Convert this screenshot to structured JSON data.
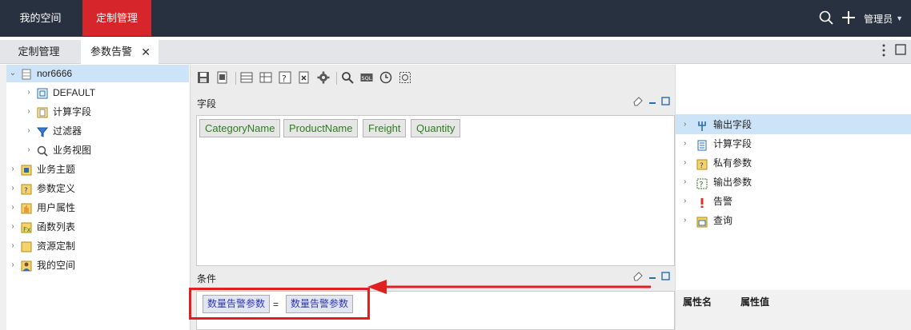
{
  "topnav": {
    "my_space": "我的空间",
    "custom": "定制管理",
    "user": "管理员"
  },
  "tabs": {
    "custom": "定制管理",
    "param_alert": "参数告警"
  },
  "tree": [
    {
      "label": "nor6666",
      "icon": "database-icon",
      "level": 0,
      "expanded": true
    },
    {
      "label": "DEFAULT",
      "icon": "schema-icon",
      "level": 1
    },
    {
      "label": "计算字段",
      "icon": "calc-field-icon",
      "level": 1
    },
    {
      "label": "过滤器",
      "icon": "filter-icon",
      "level": 1
    },
    {
      "label": "业务视图",
      "icon": "search-icon",
      "level": 1
    },
    {
      "label": "业务主题",
      "icon": "subject-icon",
      "level": 0
    },
    {
      "label": "参数定义",
      "icon": "param-icon",
      "level": 0
    },
    {
      "label": "用户属性",
      "icon": "user-attr-icon",
      "level": 0
    },
    {
      "label": "函数列表",
      "icon": "function-icon",
      "level": 0
    },
    {
      "label": "资源定制",
      "icon": "folder-icon",
      "level": 0
    },
    {
      "label": "我的空间",
      "icon": "user-icon",
      "level": 0
    }
  ],
  "sections": {
    "fields": "字段",
    "conditions": "条件"
  },
  "fields": [
    "CategoryName",
    "ProductName",
    "Freight",
    "Quantity"
  ],
  "condition": {
    "left": "数量告警参数",
    "op": "=",
    "right": "数量告警参数"
  },
  "right_tree": [
    {
      "label": "输出字段",
      "icon": "output-field-icon"
    },
    {
      "label": "计算字段",
      "icon": "calc-field-icon"
    },
    {
      "label": "私有参数",
      "icon": "private-param-icon"
    },
    {
      "label": "输出参数",
      "icon": "output-param-icon"
    },
    {
      "label": "告警",
      "icon": "alert-icon"
    },
    {
      "label": "查询",
      "icon": "query-icon"
    }
  ],
  "props": {
    "name": "属性名",
    "value": "属性值"
  },
  "colors": {
    "topbar": "#27313f",
    "accent": "#d6262b",
    "highlight": "#cde3f7",
    "field_text": "#2e7d1e",
    "cond_text": "#2a3aa8"
  }
}
